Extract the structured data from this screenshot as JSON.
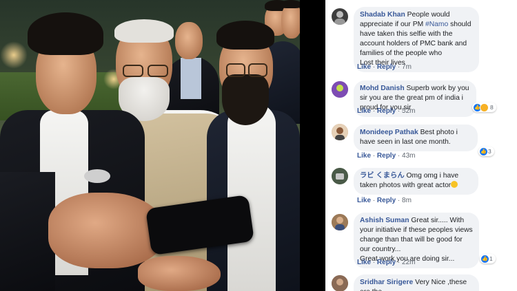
{
  "comments": [
    {
      "name": "Shadab Khan",
      "text_before": "People would appreciate if our PM ",
      "hashtag": "#Namo",
      "text_after": " should have taken this selfie with the account holders of PMC bank and families of the people who",
      "text_line2": "Lost their lives",
      "like": "Like",
      "reply": "Reply",
      "time": "7m",
      "avatar_color": "#3d3d3d"
    },
    {
      "name": "Mohd Danish",
      "text": "Superb work by you sir you are the great pm of india i proud for you sir",
      "like": "Like",
      "reply": "Reply",
      "time": "52m",
      "reaction_count": "8",
      "avatar_color": "#6b3fa0"
    },
    {
      "name": "Monideep Pathak",
      "text": "Best photo i have seen in last one month.",
      "like": "Like",
      "reply": "Reply",
      "time": "43m",
      "reaction_count": "3",
      "avatar_color": "#c9a17a"
    },
    {
      "name": "ラビ くまらん",
      "text": "Omg omg i have taken photos with great actor",
      "like": "Like",
      "reply": "Reply",
      "time": "8m",
      "avatar_color": "#5a6b52"
    },
    {
      "name": "Ashish Suman",
      "text": "Great sir..... With your initiative if these peoples views change than that will be good for our country...",
      "text_line2": "Great work you are doing sir...",
      "like": "Like",
      "reply": "Reply",
      "time": "22m",
      "reaction_count": "1",
      "avatar_color": "#8a6a4a"
    },
    {
      "name": "Sridhar Sirigere",
      "text": "Very Nice ,these are the",
      "avatar_color": "#7a5a48"
    }
  ],
  "colors": {
    "name_blue": "#385898",
    "bubble_bg": "#f0f2f5",
    "divider": "#000000",
    "like_blue": "#1877f2",
    "haha_yellow": "#f7b125"
  },
  "icons": {
    "like_reaction": "thumbs-up-icon",
    "haha_reaction": "haha-face-icon",
    "emoji": "laughing-emoji-icon"
  }
}
